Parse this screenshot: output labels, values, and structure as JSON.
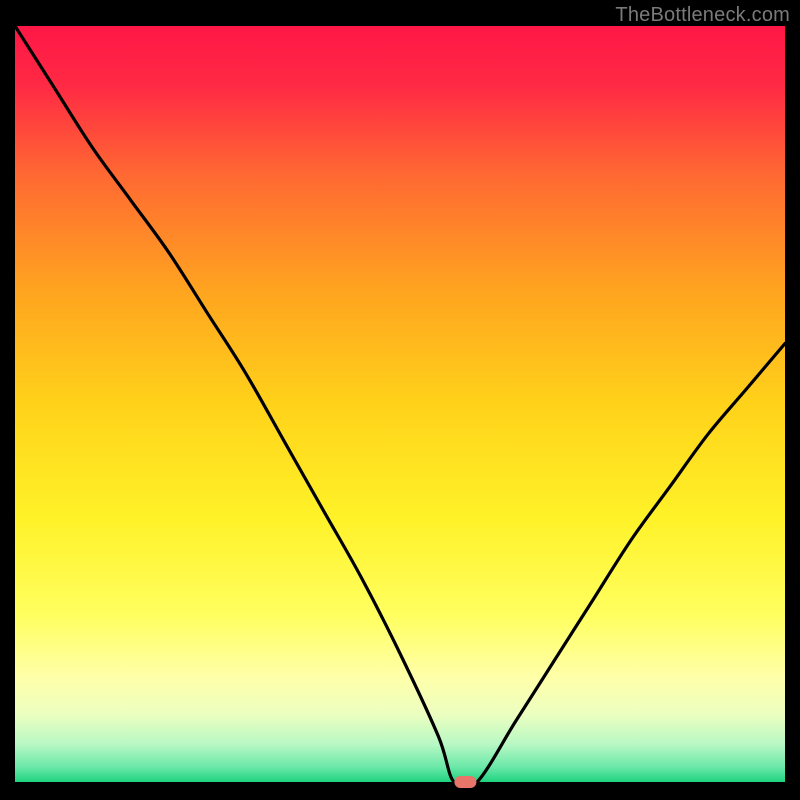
{
  "watermark": "TheBottleneck.com",
  "chart_data": {
    "type": "line",
    "title": "",
    "xlabel": "",
    "ylabel": "",
    "xlim": [
      0,
      100
    ],
    "ylim": [
      0,
      100
    ],
    "x": [
      0,
      5,
      10,
      15,
      20,
      25,
      30,
      35,
      40,
      45,
      50,
      55,
      57,
      60,
      65,
      70,
      75,
      80,
      85,
      90,
      95,
      100
    ],
    "values": [
      100,
      92,
      84,
      77,
      70,
      62,
      54,
      45,
      36,
      27,
      17,
      6,
      0,
      0,
      8,
      16,
      24,
      32,
      39,
      46,
      52,
      58
    ],
    "marker": {
      "x": 58.5,
      "y": 0
    },
    "background": "rainbow-vertical-gradient",
    "grid": false,
    "legend": false
  }
}
